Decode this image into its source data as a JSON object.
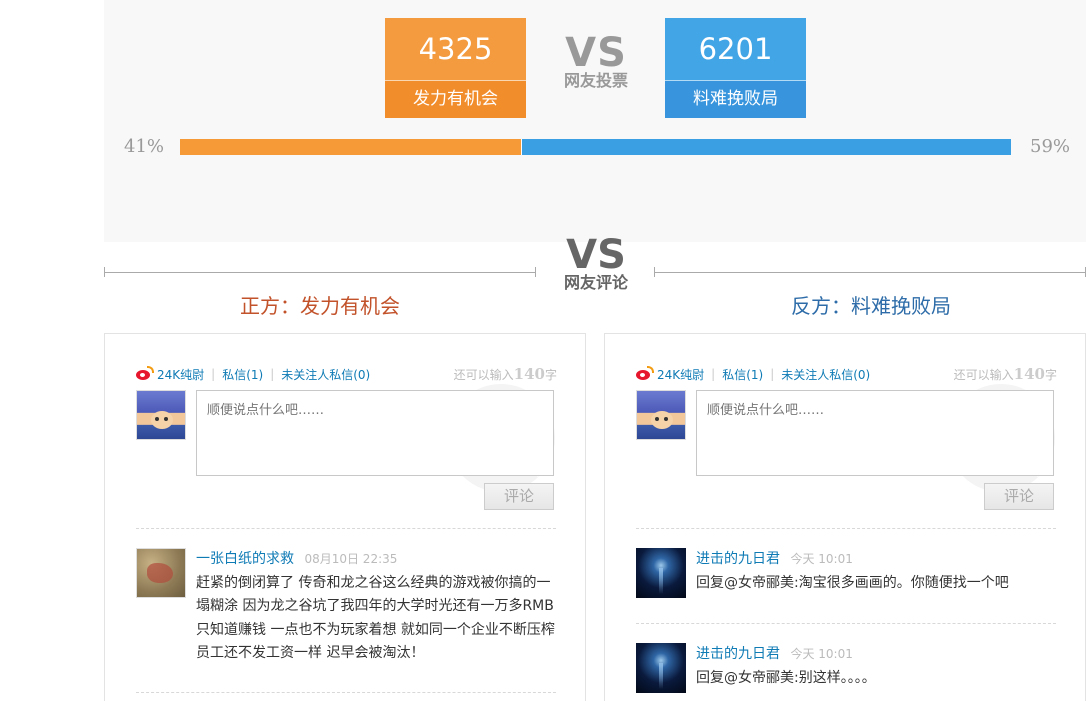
{
  "vote": {
    "left": {
      "count": "4325",
      "label": "发力有机会",
      "percent_text": "41%",
      "percent": 0.41
    },
    "right": {
      "count": "6201",
      "label": "料难挽败局",
      "percent_text": "59%"
    },
    "vs": "VS",
    "vs_sub": "网友投票",
    "colors": {
      "left": "#f39b3e",
      "right": "#42a5e6"
    }
  },
  "comments_header": {
    "vs": "VS",
    "vs_sub": "网友评论",
    "left_title": "正方：发力有机会",
    "right_title": "反方：料难挽败局"
  },
  "weibo": {
    "username": "24K纯尉",
    "messages": "私信(1)",
    "unfollowed_messages": "未关注人私信(0)",
    "limit_prefix": "还可以输入",
    "limit_count": "140",
    "limit_suffix": "字",
    "placeholder": "顺便说点什么吧……",
    "submit": "评论"
  },
  "left_comments": [
    {
      "name": "一张白纸的求救",
      "time": "08月10日 22:35",
      "text": "赶紧的倒闭算了 传奇和龙之谷这么经典的游戏被你搞的一塌糊涂 因为龙之谷坑了我四年的大学时光还有一万多RMB 只知道赚钱 一点也不为玩家着想 就如同一个企业不断压榨员工还不发工资一样 迟早会被淘汰！",
      "avatar_icon": "map-avatar-icon"
    }
  ],
  "right_comments": [
    {
      "name": "进击的九日君",
      "time": "今天 10:01",
      "text": "回复@女帝郦美:淘宝很多画画的。你随便找一个吧",
      "avatar_icon": "jellyfish-avatar-icon"
    },
    {
      "name": "进击的九日君",
      "time": "今天 10:01",
      "text": "回复@女帝郦美:别这样。。。。",
      "avatar_icon": "jellyfish-avatar-icon"
    }
  ]
}
